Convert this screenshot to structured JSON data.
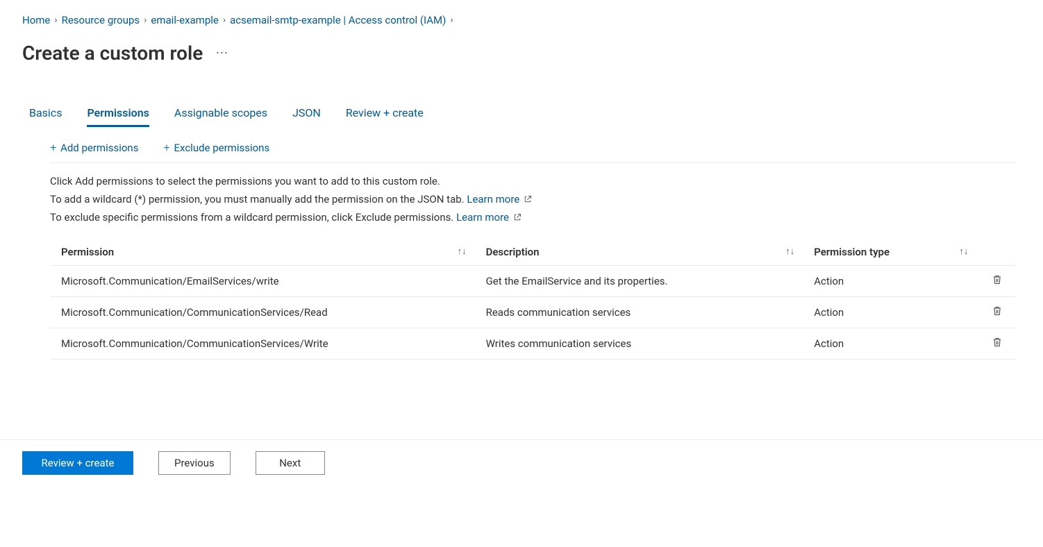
{
  "breadcrumb": {
    "items": [
      {
        "label": "Home"
      },
      {
        "label": "Resource groups"
      },
      {
        "label": "email-example"
      },
      {
        "label": "acsemail-smtp-example | Access control (IAM)"
      }
    ]
  },
  "page_title": "Create a custom role",
  "tabs": [
    {
      "label": "Basics",
      "active": false
    },
    {
      "label": "Permissions",
      "active": true
    },
    {
      "label": "Assignable scopes",
      "active": false
    },
    {
      "label": "JSON",
      "active": false
    },
    {
      "label": "Review + create",
      "active": false
    }
  ],
  "toolbar": {
    "add_label": "Add permissions",
    "exclude_label": "Exclude permissions"
  },
  "info": {
    "line1": "Click Add permissions to select the permissions you want to add to this custom role.",
    "line2_a": "To add a wildcard (*) permission, you must manually add the permission on the JSON tab. ",
    "line3_a": "To exclude specific permissions from a wildcard permission, click Exclude permissions. ",
    "learn_more": "Learn more"
  },
  "table": {
    "headers": {
      "permission": "Permission",
      "description": "Description",
      "ptype": "Permission type"
    },
    "rows": [
      {
        "permission": "Microsoft.Communication/EmailServices/write",
        "description": "Get the EmailService and its properties.",
        "ptype": "Action"
      },
      {
        "permission": "Microsoft.Communication/CommunicationServices/Read",
        "description": "Reads communication services",
        "ptype": "Action"
      },
      {
        "permission": "Microsoft.Communication/CommunicationServices/Write",
        "description": "Writes communication services",
        "ptype": "Action"
      }
    ]
  },
  "footer": {
    "review_create": "Review + create",
    "previous": "Previous",
    "next": "Next"
  }
}
